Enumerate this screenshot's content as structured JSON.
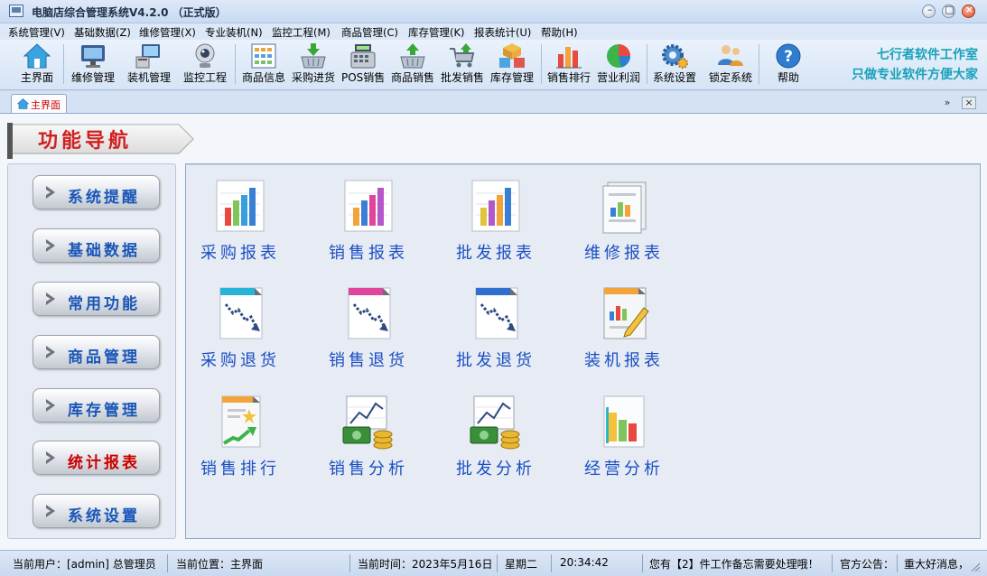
{
  "window": {
    "title": "电脑店综合管理系统V4.2.0 （正式版）"
  },
  "menu": [
    "系统管理(V)",
    "基础数据(Z)",
    "维修管理(X)",
    "专业装机(N)",
    "监控工程(M)",
    "商品管理(C)",
    "库存管理(K)",
    "报表统计(U)",
    "帮助(H)"
  ],
  "toolbar": {
    "items": [
      {
        "label": "主界面",
        "icon": "home-icon"
      },
      {
        "label": "维修管理",
        "icon": "monitor-icon"
      },
      {
        "label": "装机管理",
        "icon": "computer-icon"
      },
      {
        "label": "监控工程",
        "icon": "webcam-icon"
      },
      {
        "label": "商品信息",
        "icon": "grid-icon"
      },
      {
        "label": "采购进货",
        "icon": "basket-down-icon"
      },
      {
        "label": "POS销售",
        "icon": "cash-register-icon"
      },
      {
        "label": "商品销售",
        "icon": "basket-up-icon"
      },
      {
        "label": "批发销售",
        "icon": "cart-icon"
      },
      {
        "label": "库存管理",
        "icon": "boxes-icon"
      },
      {
        "label": "销售排行",
        "icon": "bar-chart-icon"
      },
      {
        "label": "营业利润",
        "icon": "pie-chart-icon"
      },
      {
        "label": "系统设置",
        "icon": "gear-icon"
      },
      {
        "label": "锁定系统",
        "icon": "users-lock-icon"
      },
      {
        "label": "帮助",
        "icon": "help-icon"
      }
    ],
    "studio_line1": "七行者软件工作室",
    "studio_line2": "只做专业软件方便大家"
  },
  "tabs": {
    "home_label": "主界面"
  },
  "banner": {
    "title": "功能导航"
  },
  "sidebar": {
    "items": [
      {
        "label": "系统提醒"
      },
      {
        "label": "基础数据"
      },
      {
        "label": "常用功能"
      },
      {
        "label": "商品管理"
      },
      {
        "label": "库存管理"
      },
      {
        "label": "统计报表",
        "active": true
      },
      {
        "label": "系统设置"
      }
    ]
  },
  "functions": [
    {
      "label": "采购报表",
      "icon": "report-chart-icon"
    },
    {
      "label": "销售报表",
      "icon": "report-chart-icon"
    },
    {
      "label": "批发报表",
      "icon": "report-chart-icon"
    },
    {
      "label": "维修报表",
      "icon": "document-chart-icon"
    },
    {
      "label": "采购退货",
      "icon": "return-chart-icon"
    },
    {
      "label": "销售退货",
      "icon": "return-chart-icon"
    },
    {
      "label": "批发退货",
      "icon": "return-chart-icon"
    },
    {
      "label": "装机报表",
      "icon": "report-pen-icon"
    },
    {
      "label": "销售排行",
      "icon": "ranking-icon"
    },
    {
      "label": "销售分析",
      "icon": "money-chart-icon"
    },
    {
      "label": "批发分析",
      "icon": "money-chart-icon"
    },
    {
      "label": "经营分析",
      "icon": "business-chart-icon"
    }
  ],
  "status": {
    "user": "当前用户：[admin] 总管理员",
    "location": "当前位置：主界面",
    "date": "当前时间：2023年5月16日",
    "weekday": "星期二",
    "time": "20:34:42",
    "todo": "您有【2】件工作备忘需要处理哦！",
    "notice_label": "官方公告：",
    "notice": "重大好消息，"
  },
  "colors": {
    "accent_blue": "#1b4fc3",
    "active_red": "#cc0000",
    "studio_teal": "#17a1b8"
  }
}
